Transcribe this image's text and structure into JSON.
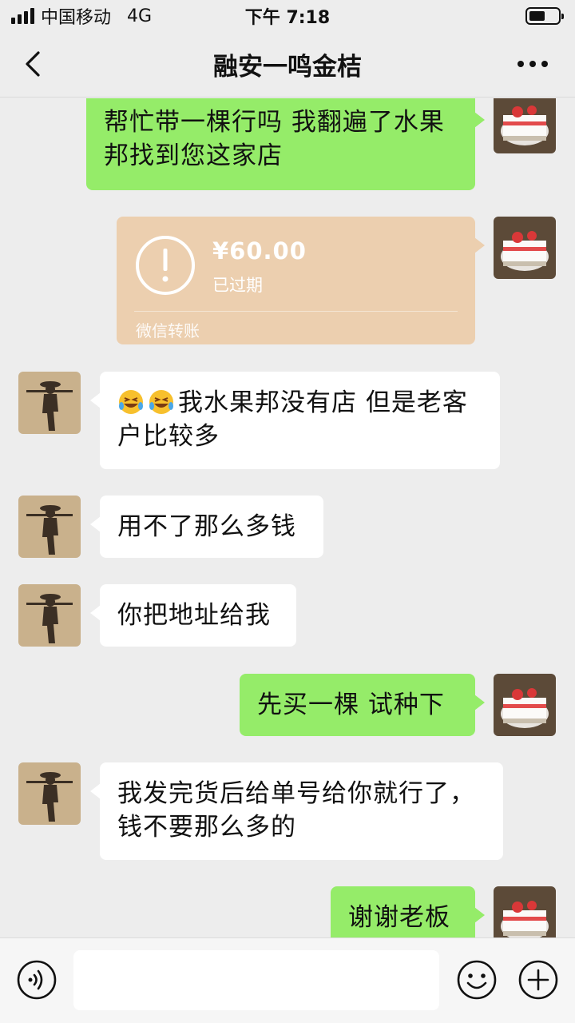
{
  "status_bar": {
    "carrier": "中国移动",
    "network": "4G",
    "time": "下午 7:18",
    "battery_level_percent": 55
  },
  "header": {
    "title": "融安一鸣金桔",
    "back_icon": "chevron-left-icon",
    "more_icon": "more-dots-icon"
  },
  "messages": [
    {
      "sender": "me",
      "text": "帮忙带一棵行吗 我翻遍了水果邦找到您这家店"
    },
    {
      "sender": "me",
      "type": "transfer",
      "amount": "¥60.00",
      "status": "已过期",
      "footer": "微信转账"
    },
    {
      "sender": "them",
      "emoji": "grinning-squinting-face-with-tears",
      "text": "我水果邦没有店 但是老客户比较多"
    },
    {
      "sender": "them",
      "text": "用不了那么多钱"
    },
    {
      "sender": "them",
      "text": "你把地址给我"
    },
    {
      "sender": "me",
      "text": "先买一棵 试种下"
    },
    {
      "sender": "them",
      "text": "我发完货后给单号给你就行了，钱不要那么多的"
    },
    {
      "sender": "me",
      "text": "谢谢老板"
    }
  ],
  "input_bar": {
    "voice_icon": "voice-icon",
    "input_value": "",
    "emoji_icon": "emoji-icon",
    "plus_icon": "plus-icon"
  },
  "colors": {
    "background": "#ededed",
    "my_bubble": "#95ec69",
    "their_bubble": "#ffffff",
    "transfer_card": "#eccfaf"
  }
}
